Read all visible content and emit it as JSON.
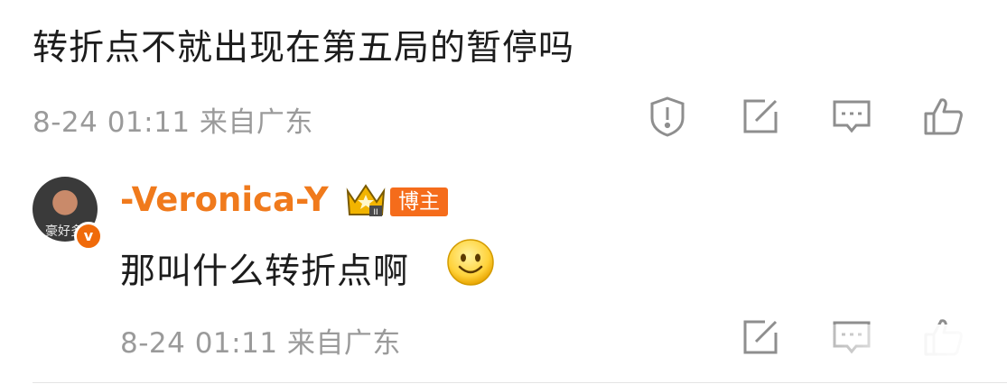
{
  "comment1": {
    "text": "转折点不就出现在第五局的暂停吗",
    "meta": "8-24 01:11 来自广东",
    "icons": [
      "report-icon",
      "share-icon",
      "comment-icon",
      "like-icon"
    ]
  },
  "reply": {
    "username": "-Veronica-Y",
    "badge_label": "博主",
    "avatar_watermark": "豪好多",
    "verified_label": "v",
    "text": "那叫什么转折点啊",
    "emoji": "smile-emoji",
    "meta": "8-24 01:11 来自广东",
    "icons": [
      "share-icon",
      "comment-icon",
      "like-icon"
    ]
  },
  "colors": {
    "username": "#f07a1c",
    "badge_bg": "#f56c1b",
    "meta": "#9a9a9a",
    "icon": "#8e8e8e",
    "crown": "#f2b400"
  }
}
